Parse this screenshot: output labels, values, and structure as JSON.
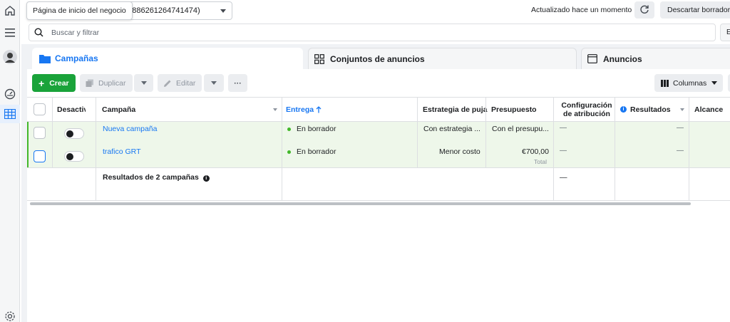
{
  "tooltip": {
    "text": "Página de inicio del negocio"
  },
  "account": {
    "label": "z (886261264741474)"
  },
  "topbar": {
    "updated": "Actualizado hace un momento",
    "discard": "Descartar borradores"
  },
  "search": {
    "placeholder": "Buscar y filtrar",
    "extra": "E"
  },
  "tabs": [
    {
      "label": "Campañas"
    },
    {
      "label": "Conjuntos de anuncios"
    },
    {
      "label": "Anuncios"
    }
  ],
  "toolbar": {
    "create": "Crear",
    "duplicate": "Duplicar",
    "edit": "Editar",
    "more": "···",
    "columns": "Columnas"
  },
  "table": {
    "headers": {
      "off": "Desactiv",
      "campaign": "Campaña",
      "delivery": "Entrega",
      "bid": "Estrategia de puja",
      "budget": "Presupuesto",
      "attribution_1": "Configuración",
      "attribution_2": "de atribución",
      "results": "Resultados",
      "reach": "Alcance"
    },
    "rows": [
      {
        "name": "Nueva campaña",
        "delivery": "En borrador",
        "bid": "Con estrategia ...",
        "budget": "Con el presupu...",
        "budget_sub": "",
        "attribution": "—",
        "results": "—"
      },
      {
        "name": "trafico GRT",
        "delivery": "En borrador",
        "bid": "Menor costo",
        "budget": "€700,00",
        "budget_sub": "Total",
        "attribution": "—",
        "results": "—"
      }
    ],
    "summary": {
      "label": "Resultados de 2 campañas",
      "attribution": "—"
    }
  },
  "colors": {
    "accent": "#1877f2",
    "create": "#1aa33a",
    "row_highlight": "#eef7ea",
    "status_green": "#42b72a"
  }
}
